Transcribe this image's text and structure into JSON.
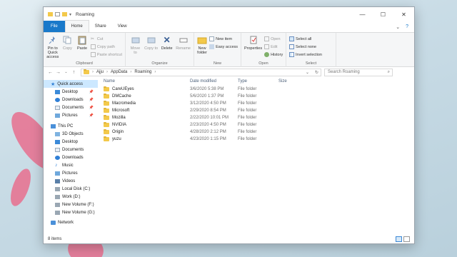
{
  "window": {
    "title": "Roaming",
    "controls": {
      "minimize": "—",
      "maximize": "☐",
      "close": "✕"
    }
  },
  "ribbon_tabs": [
    "File",
    "Home",
    "Share",
    "View"
  ],
  "ribbon": {
    "clipboard": {
      "label": "Clipboard",
      "pin_to_quick_access": "Pin to Quick access",
      "copy": "Copy",
      "paste": "Paste",
      "cut": "Cut",
      "copy_path": "Copy path",
      "paste_shortcut": "Paste shortcut"
    },
    "organize": {
      "label": "Organize",
      "move_to": "Move to",
      "copy_to": "Copy to",
      "delete": "Delete",
      "rename": "Rename"
    },
    "new": {
      "label": "New",
      "new_folder": "New folder",
      "new_item": "New item",
      "easy_access": "Easy access"
    },
    "open": {
      "label": "Open",
      "properties": "Properties",
      "open": "Open",
      "edit": "Edit",
      "history": "History"
    },
    "select": {
      "label": "Select",
      "select_all": "Select all",
      "select_none": "Select none",
      "invert_selection": "Invert selection"
    }
  },
  "address": {
    "path": [
      "Ajju",
      "AppData",
      "Roaming"
    ],
    "search_placeholder": "Search Roaming"
  },
  "nav_pane": {
    "quick_access": "Quick access",
    "quick_items": [
      "Desktop",
      "Downloads",
      "Documents",
      "Pictures"
    ],
    "this_pc": "This PC",
    "pc_items": [
      "3D Objects",
      "Desktop",
      "Documents",
      "Downloads",
      "Music",
      "Pictures",
      "Videos",
      "Local Disk (C:)",
      "Work (D:)",
      "New Volume (F:)",
      "New Volume (G:)"
    ],
    "network": "Network"
  },
  "columns": {
    "name": "Name",
    "date": "Date modified",
    "type": "Type",
    "size": "Size"
  },
  "files": [
    {
      "name": "CareUEyes",
      "date": "3/6/2020 5:38 PM",
      "type": "File folder"
    },
    {
      "name": "DMCache",
      "date": "5/6/2020 1:37 PM",
      "type": "File folder"
    },
    {
      "name": "Macromedia",
      "date": "3/12/2020 4:50 PM",
      "type": "File folder"
    },
    {
      "name": "Microsoft",
      "date": "2/29/2020 8:54 PM",
      "type": "File folder"
    },
    {
      "name": "Mozilla",
      "date": "2/22/2020 10:01 PM",
      "type": "File folder"
    },
    {
      "name": "NVIDIA",
      "date": "2/23/2020 4:50 PM",
      "type": "File folder"
    },
    {
      "name": "Origin",
      "date": "4/28/2020 2:12 PM",
      "type": "File folder"
    },
    {
      "name": "yuzu",
      "date": "4/23/2020 1:15 PM",
      "type": "File folder"
    }
  ],
  "status": {
    "count": "8 items"
  },
  "colors": {
    "file_tab": "#1979ca",
    "selection": "#cce8ff",
    "folder": "#f3c94a",
    "petal": "#e86f8e"
  }
}
